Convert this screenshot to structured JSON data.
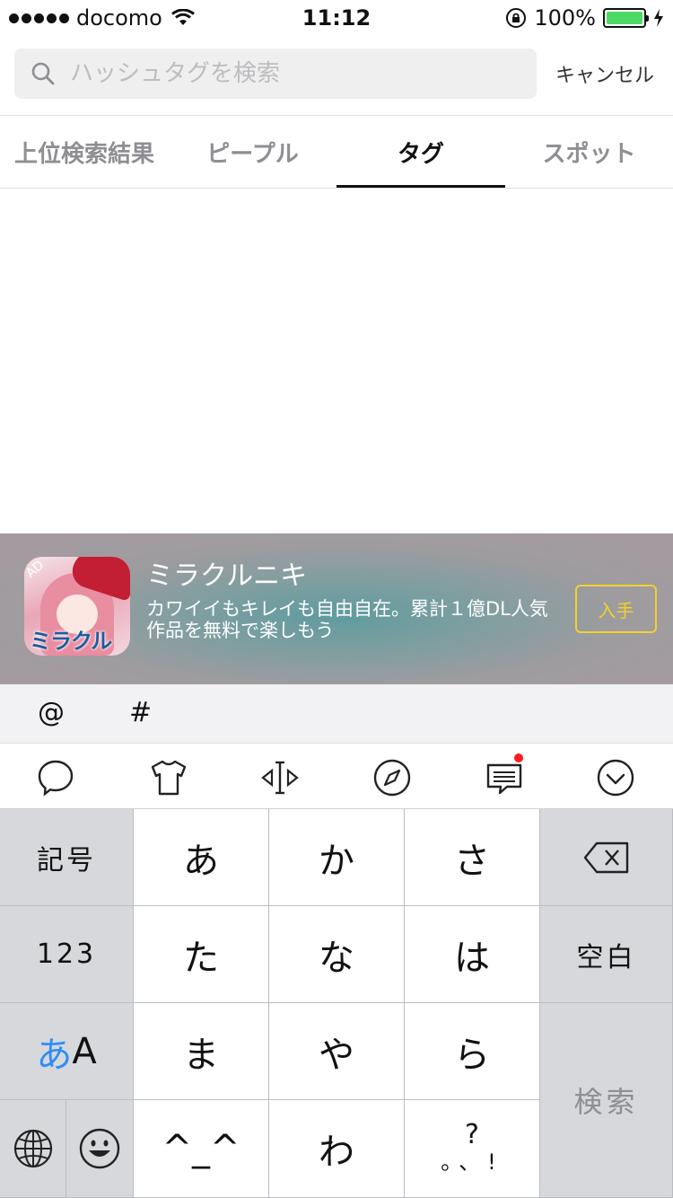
{
  "status_bar": {
    "carrier": "docomo",
    "time": "11:12",
    "battery_text": "100%",
    "battery_level": 1.0,
    "battery_color": "#4cd964"
  },
  "search": {
    "placeholder": "ハッシュタグを検索",
    "value": "",
    "cancel_label": "キャンセル"
  },
  "tabs": [
    {
      "label": "上位検索結果",
      "active": false
    },
    {
      "label": "ピープル",
      "active": false
    },
    {
      "label": "タグ",
      "active": true
    },
    {
      "label": "スポット",
      "active": false
    }
  ],
  "ad": {
    "badge": "AD",
    "app_logo_text": "ミラクルニキ",
    "title": "ミラクルニキ",
    "description": "カワイイもキレイも自由自在。累計１億DL人気作品を無料で楽しもう",
    "cta_label": "入手",
    "cta_color": "#f2d12b"
  },
  "symbol_row": {
    "at": "@",
    "hash": "#"
  },
  "toolbar": {
    "icons": [
      "speech-bubble-icon",
      "tshirt-icon",
      "cursor-move-icon",
      "compass-icon",
      "message-icon",
      "chevron-down-circle-icon"
    ],
    "notification_color": "#ff1a1a"
  },
  "keyboard": {
    "kigo": "記号",
    "num": "123",
    "kana_a": "あ",
    "kana_A": "A",
    "row1": [
      "あ",
      "か",
      "さ"
    ],
    "row2": [
      "た",
      "な",
      "は"
    ],
    "row3": [
      "ま",
      "や",
      "ら"
    ],
    "row4": [
      "^_^",
      "わ"
    ],
    "punct_top": "?",
    "punct_bottom": "。、!",
    "space": "空白",
    "search": "検索",
    "accent_color": "#2f8df5"
  }
}
